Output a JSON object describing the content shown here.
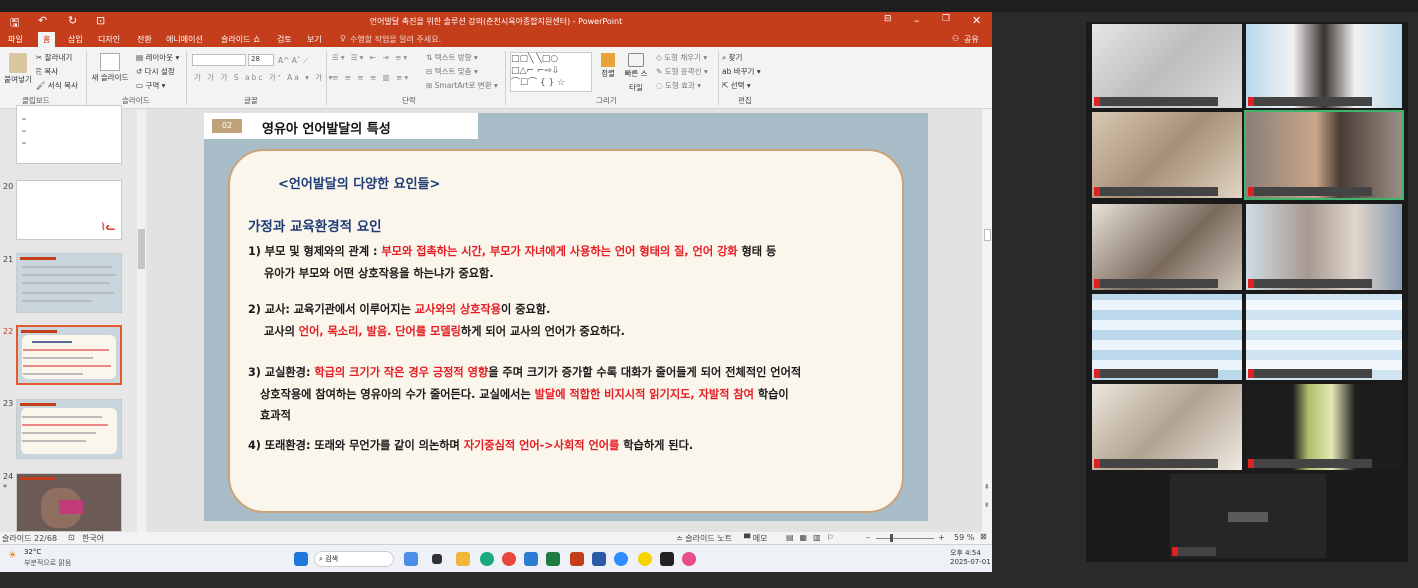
{
  "window": {
    "title": "언어발달 촉진을 위한 솔루션 강의(춘천시육아종합지원센터) - PowerPoint",
    "icons": [
      "save-icon",
      "undo-icon",
      "redo-icon",
      "present-icon"
    ]
  },
  "tabs": [
    "파일",
    "홈",
    "삽입",
    "디자인",
    "전환",
    "애니메이션",
    "슬라이드 쇼",
    "검토",
    "보기"
  ],
  "active_tab": "홈",
  "tell_me": "수행할 작업을 알려 주세요.",
  "share": "공유",
  "ribbon": {
    "clipboard": {
      "paste": "붙여넣기",
      "cut": "잘라내기",
      "copy": "복사",
      "format": "서식 복사",
      "label": "클립보드"
    },
    "slides": {
      "new_slide": "새 슬라이드",
      "layout": "레이아웃",
      "reset": "다시 설정",
      "section": "구역",
      "label": "슬라이드"
    },
    "font": {
      "name": "",
      "size": "28",
      "label": "글꼴"
    },
    "paragraph": {
      "direction": "텍스트 방향",
      "align": "텍스트 맞춤",
      "smartart": "SmartArt로 변환",
      "label": "단락"
    },
    "drawing": {
      "arrange": "정렬",
      "quick_styles": "빠른 스타일",
      "fill": "도형 채우기",
      "outline": "도형 윤곽선",
      "effects": "도형 효과",
      "label": "그리기"
    },
    "editing": {
      "find": "찾기",
      "replace": "바꾸기",
      "select": "선택",
      "label": "편집"
    }
  },
  "thumbnails": [
    {
      "num": ""
    },
    {
      "num": "20"
    },
    {
      "num": "21"
    },
    {
      "num": "22",
      "selected": true
    },
    {
      "num": "23"
    },
    {
      "num": "24",
      "star": "*"
    }
  ],
  "slide": {
    "section_num": "02",
    "section_title": "영유아 언어발달의 특성",
    "subtitle": "<언어발달의 다양한 요인들>",
    "heading": "가정과 교육환경적 요인",
    "l1a": "1) 부모 및 형제와의 관계 : ",
    "l1b": "부모와 접촉하는 시간, 부모가 자녀에게 사용하는 언어 형태의 질, 언어 강화",
    "l1c": " 형태 등",
    "l2": "유아가 부모와 어떤 상호작용을 하는냐가 중요함.",
    "l3a": "2) 교사: 교육기관에서 이루어지는 ",
    "l3b": "교사와의 상호작용",
    "l3c": "이 중요함.",
    "l4a": "교사의 ",
    "l4b": "언어, 목소리, 발음. 단어를 모델링",
    "l4c": "하게 되어 교사의 언어가 중요하다.",
    "l5a": "3) 교실환경: ",
    "l5b": "학급의 크기가 작은 경우 긍정적 영향",
    "l5c": "을 주며 크기가 증가할 수록 대화가 줄어들게 되어 전체적인 언어적",
    "l6a": "상호작용에 참여하는 영유아의 수가 줄어든다. 교실에서는 ",
    "l6b": "발달에 적합한 비지시적 읽기지도, 자발적 참여",
    "l6c": " 학습이",
    "l7": "효과적",
    "l8a": "4) 또래환경: 또래와 무언가를 같이 의논하며 ",
    "l8b": "자기중심적 언어->사회적 언어를",
    "l8c": " 학습하게 된다."
  },
  "status": {
    "slide_counter": "슬라이드 22/68",
    "language": "한국어",
    "notes": "슬라이드 노트",
    "comments": "메모",
    "zoom": "59 %"
  },
  "taskbar": {
    "weather_temp": "32°C",
    "weather_desc": "부분적으로 맑음",
    "search": "검색",
    "time": "오후 4:54",
    "date": "2025-07-01"
  },
  "colors": {
    "accent": "#c43e1c",
    "slide_bg": "#a8bcc8",
    "card_border": "#caa37b",
    "heading": "#1f3c78",
    "highlight": "#e51c23"
  }
}
